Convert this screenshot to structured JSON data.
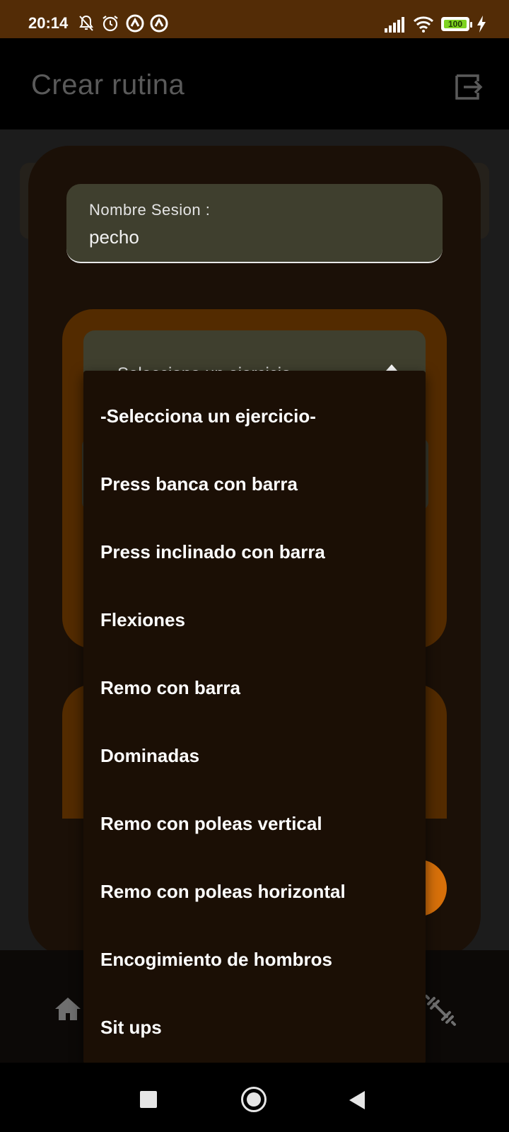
{
  "status_bar": {
    "time": "20:14",
    "battery_level": "100",
    "icons": [
      "notifications-off-icon",
      "alarm-icon",
      "app-notification-icon",
      "app-notification-icon",
      "signal-icon",
      "wifi-icon",
      "battery-icon",
      "charging-icon"
    ]
  },
  "app_bar": {
    "title": "Crear rutina",
    "exit_icon": "exit-icon"
  },
  "form": {
    "session_label": "Nombre Sesion :",
    "session_value": "pecho",
    "exercise_select_value": "-Selecciona un ejercicio-"
  },
  "dropdown": {
    "options": [
      "-Selecciona un ejercicio-",
      "Press banca con barra",
      "Press inclinado con barra",
      "Flexiones",
      "Remo con barra",
      "Dominadas",
      "Remo con poleas vertical",
      "Remo con poleas horizontal",
      "Encogimiento de hombros",
      "Sit ups"
    ]
  },
  "bottom_nav": {
    "items": [
      "home-icon",
      "dumbbell-icon"
    ]
  },
  "colors": {
    "status_bar": "#532c06",
    "accent_brown": "#532b00",
    "accent_orange": "#d7700a",
    "field_bg": "#3f3f2e",
    "dropdown_bg": "#1b0f05"
  }
}
